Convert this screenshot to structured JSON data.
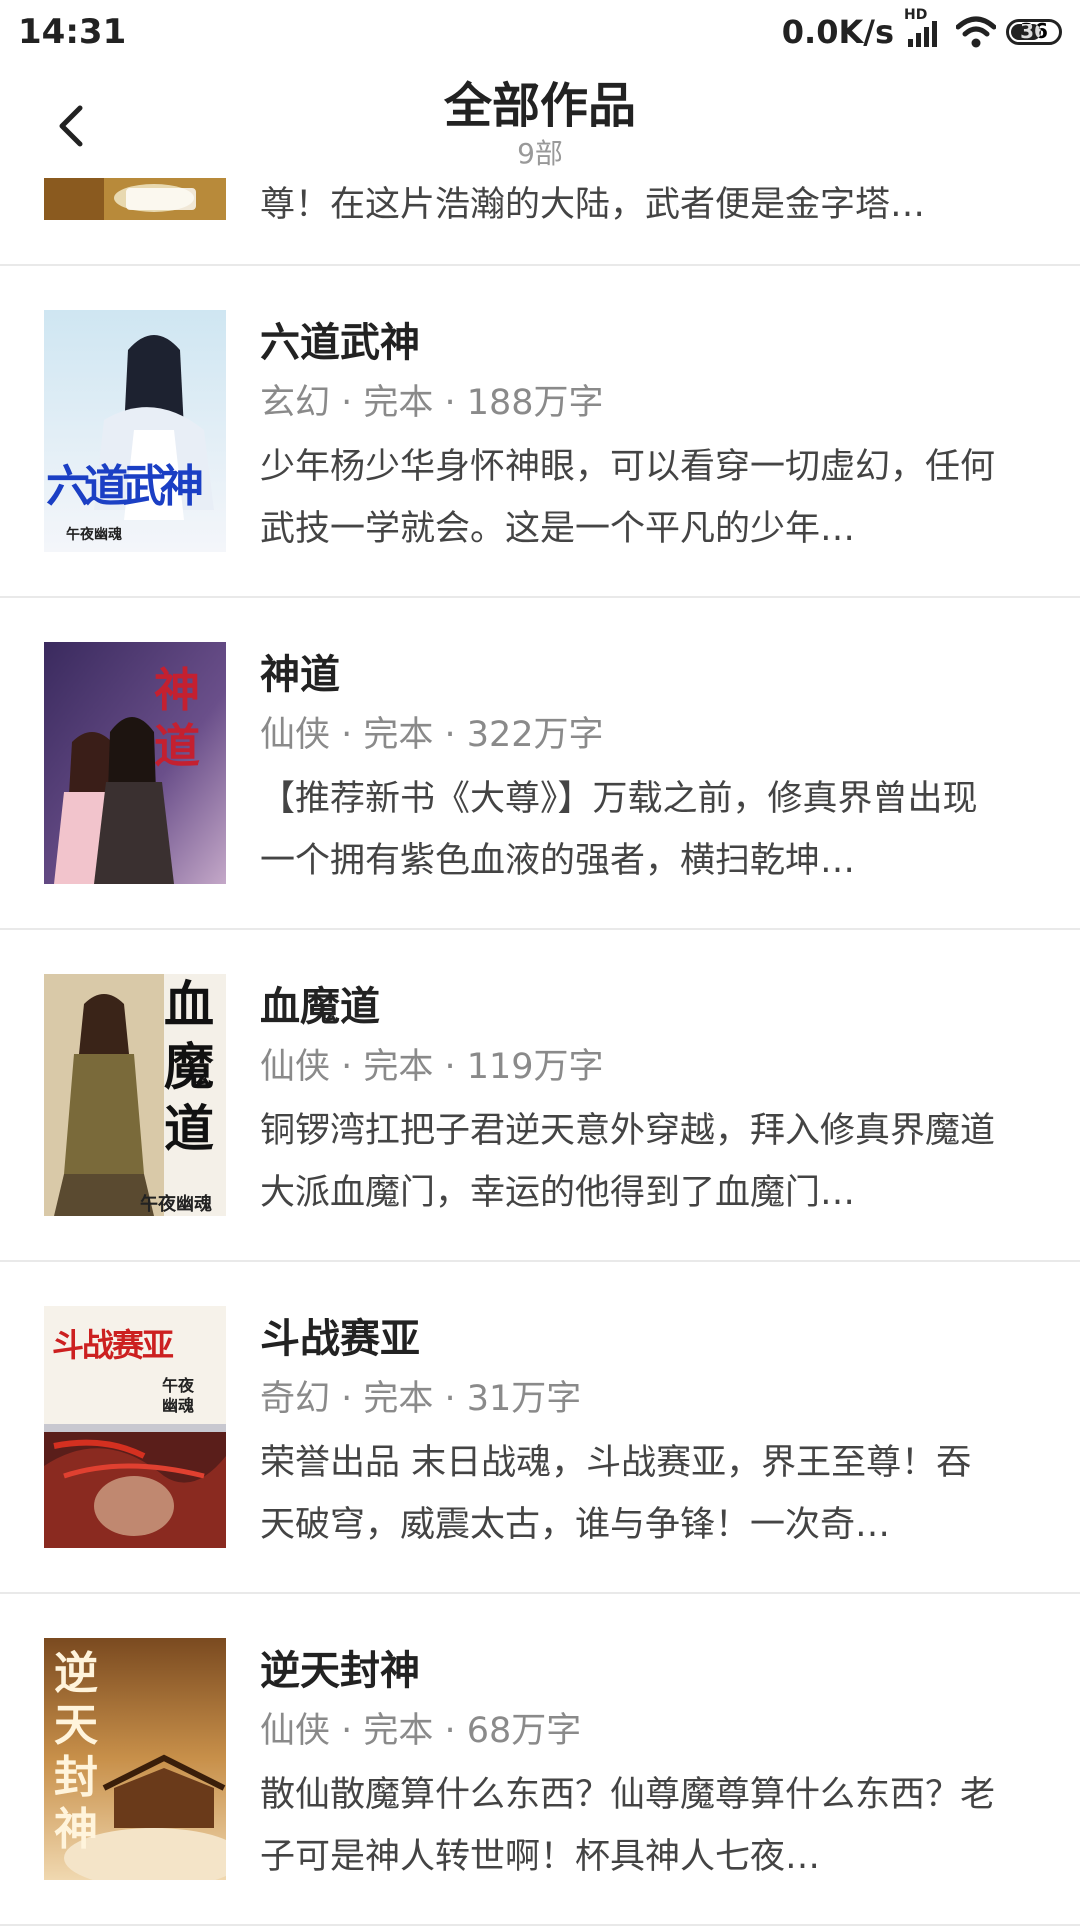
{
  "status_bar": {
    "time": "14:31",
    "net_speed": "0.0K/s",
    "network_badge": "HD",
    "battery": "36"
  },
  "header": {
    "title": "全部作品",
    "subtitle": "9部"
  },
  "partial_item": {
    "description": "尊！在这片浩瀚的大陆，武者便是金字塔…"
  },
  "books": [
    {
      "title": "六道武神",
      "meta": "玄幻 · 完本 · 188万字",
      "description": "少年杨少华身怀神眼，可以看穿一切虚幻，任何武技一学就会。这是一个平凡的少年…",
      "cover_text": "六道武神",
      "cover_author": "午夜幽魂"
    },
    {
      "title": "神道",
      "meta": "仙侠 · 完本 · 322万字",
      "description": "【推荐新书《大尊》】万载之前，修真界曾出现一个拥有紫色血液的强者，横扫乾坤…",
      "cover_text": "神道",
      "cover_author": ""
    },
    {
      "title": "血魔道",
      "meta": "仙侠 · 完本 · 119万字",
      "description": "铜锣湾扛把子君逆天意外穿越，拜入修真界魔道大派血魔门，幸运的他得到了血魔门…",
      "cover_text": "血魔道",
      "cover_author": "午夜幽魂"
    },
    {
      "title": "斗战赛亚",
      "meta": "奇幻 · 完本 · 31万字",
      "description": "荣誉出品 末日战魂，斗战赛亚，界王至尊！吞天破穹，威震太古，谁与争锋！一次奇…",
      "cover_text": "斗战赛亚",
      "cover_author": "午夜幽魂"
    },
    {
      "title": "逆天封神",
      "meta": "仙侠 · 完本 · 68万字",
      "description": "散仙散魔算什么东西？仙尊魔尊算什么东西？老子可是神人转世啊！杯具神人七夜…",
      "cover_text": "逆天封神",
      "cover_author": ""
    }
  ]
}
